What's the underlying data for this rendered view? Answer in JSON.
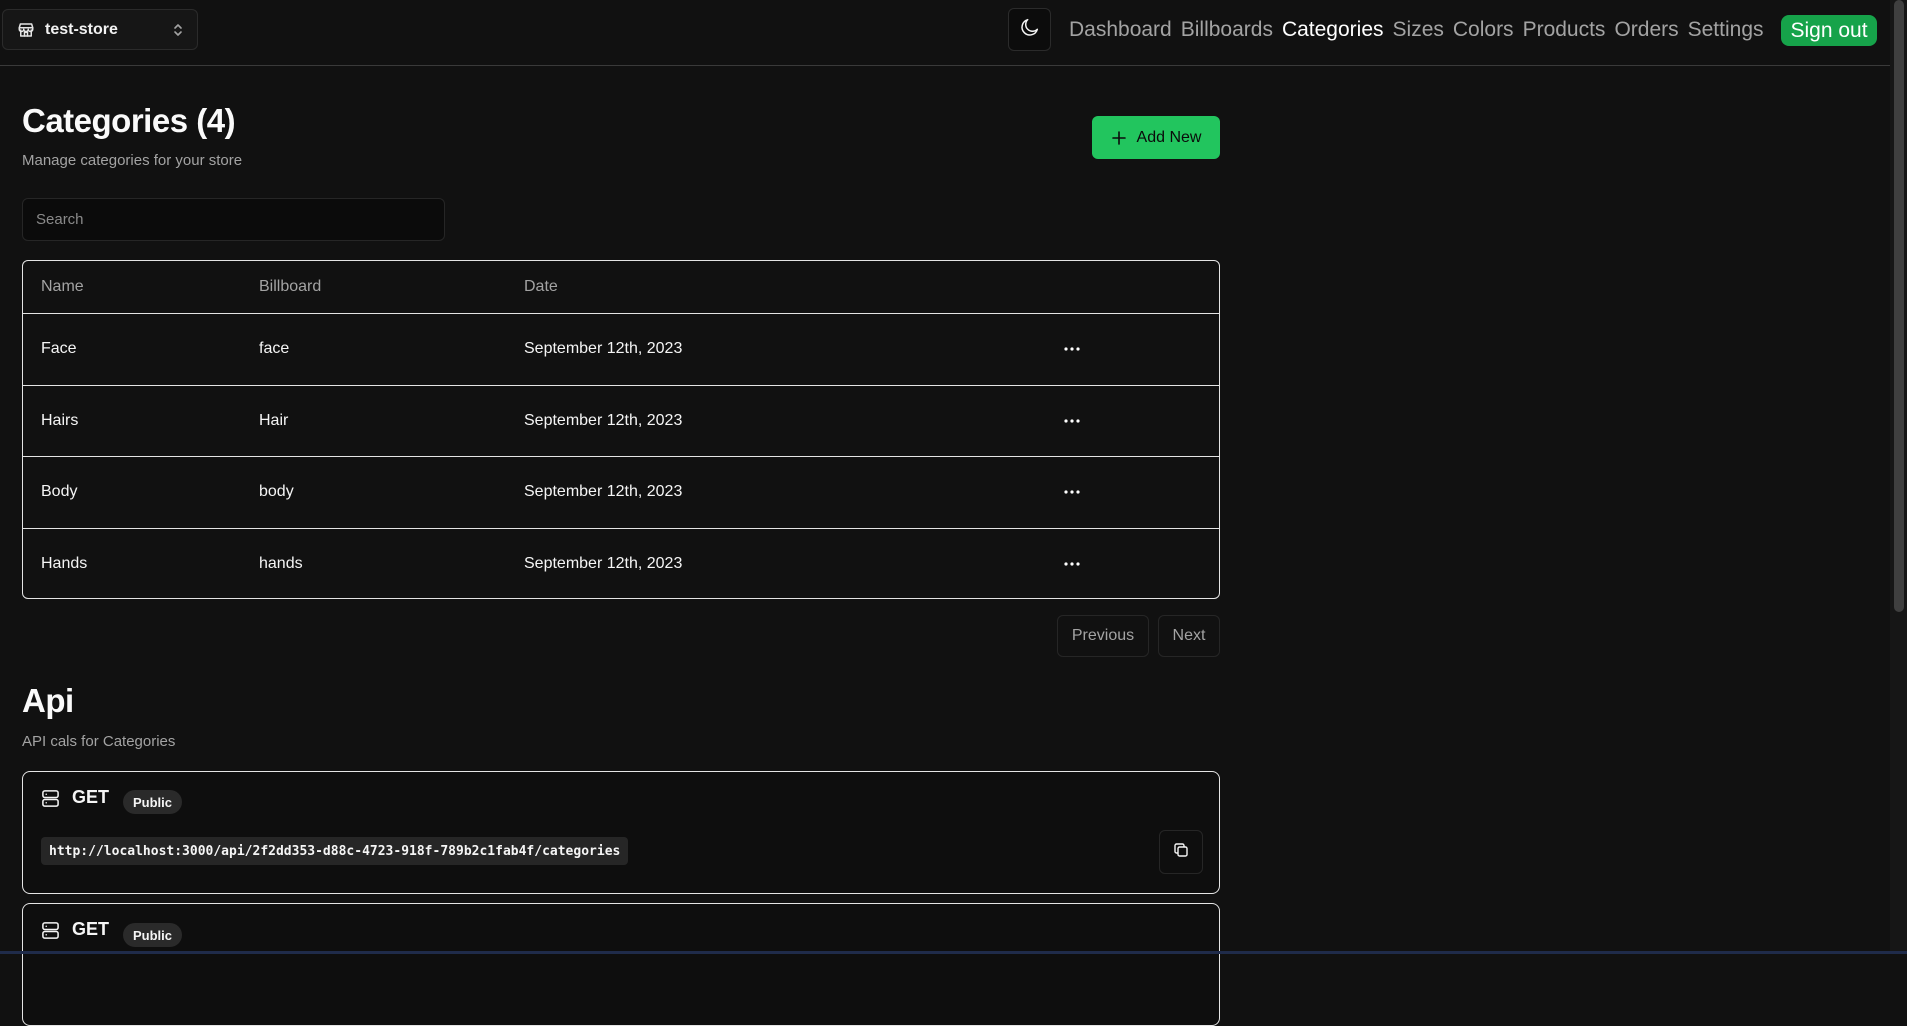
{
  "header": {
    "store_name": "test-store",
    "nav": [
      "Dashboard",
      "Billboards",
      "Categories",
      "Sizes",
      "Colors",
      "Products",
      "Orders",
      "Settings"
    ],
    "active_nav": "Categories",
    "signout_label": "Sign out",
    "accent_color": "#16a34a"
  },
  "page": {
    "title": "Categories (4)",
    "subtitle": "Manage categories for your store",
    "add_label": "Add New",
    "search_placeholder": "Search"
  },
  "table": {
    "columns": [
      "Name",
      "Billboard",
      "Date"
    ],
    "rows": [
      {
        "name": "Face",
        "billboard": "face",
        "date": "September 12th, 2023"
      },
      {
        "name": "Hairs",
        "billboard": "Hair",
        "date": "September 12th, 2023"
      },
      {
        "name": "Body",
        "billboard": "body",
        "date": "September 12th, 2023"
      },
      {
        "name": "Hands",
        "billboard": "hands",
        "date": "September 12th, 2023"
      }
    ],
    "prev_label": "Previous",
    "next_label": "Next"
  },
  "api": {
    "title": "Api",
    "subtitle": "API cals for Categories",
    "endpoints": [
      {
        "method": "GET",
        "access": "Public",
        "url": "http://localhost:3000/api/2f2dd353-d88c-4723-918f-789b2c1fab4f/categories"
      },
      {
        "method": "GET",
        "access": "Public",
        "url": ""
      }
    ]
  }
}
